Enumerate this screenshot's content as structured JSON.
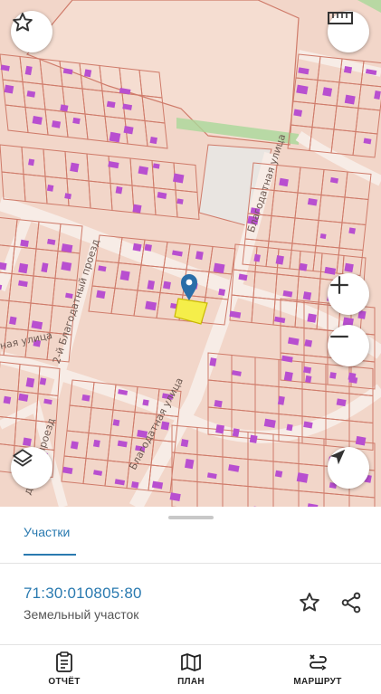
{
  "map": {
    "streets": {
      "blagodatnaya_top": "Благодатная улица",
      "blagodatnaya_proezd_2": "2-й Благодатный проезд",
      "blagodatnaya_left": "ная улица",
      "blagodatnaya_bottom": "Благодатная улица",
      "blagodatnyy_proezd_bottom": "датный проезд"
    },
    "colors": {
      "background": "#f2d6c9",
      "parcel_border": "#cf7b6a",
      "building": "#b84fd0",
      "road": "#f7ece6",
      "selected_parcel": "#f5ee4a",
      "marker": "#2a6ea8",
      "green_strip": "#a9d89a"
    }
  },
  "controls": {
    "favorite_icon": "star-outline-icon",
    "ruler_icon": "ruler-icon",
    "zoom_in_icon": "plus-icon",
    "zoom_out_icon": "minus-icon",
    "layers_icon": "layers-icon",
    "locate_icon": "navigation-arrow-icon"
  },
  "sheet": {
    "tab_label": "Участки",
    "cadastral_number": "71:30:010805:80",
    "parcel_type": "Земельный участок"
  },
  "bottom_nav": [
    {
      "label": "ОТЧЁТ",
      "icon": "clipboard-icon"
    },
    {
      "label": "ПЛАН",
      "icon": "map-icon"
    },
    {
      "label": "МАРШРУТ",
      "icon": "route-icon"
    }
  ]
}
